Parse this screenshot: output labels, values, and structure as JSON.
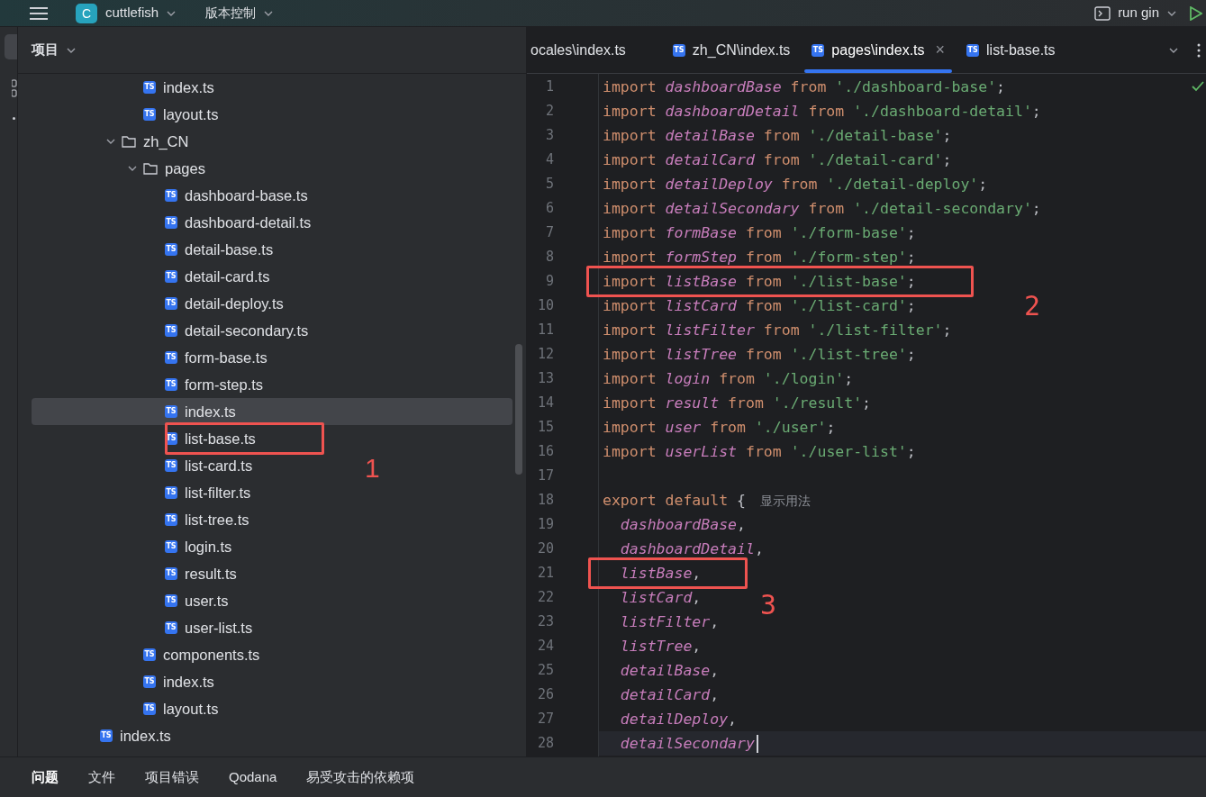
{
  "toolbar": {
    "project_badge": "C",
    "project": "cuttlefish",
    "vcs": "版本控制",
    "run_config": "run gin"
  },
  "project_panel": {
    "title": "项目",
    "tree": [
      {
        "children": [
          {
            "children": [
              {
                "name": "index.ts",
                "badge": "TS",
                "selected": false
              },
              {
                "name": "layout.ts",
                "badge": "TS",
                "selected": false
              }
            ]
          },
          {
            "name": "zh_CN",
            "expanded": true,
            "children": [
              {
                "name": "pages",
                "expanded": true,
                "children": [
                  {
                    "name": "dashboard-base.ts",
                    "badge": "TS",
                    "selected": false
                  },
                  {
                    "name": "dashboard-detail.ts",
                    "badge": "TS",
                    "selected": false
                  },
                  {
                    "name": "detail-base.ts",
                    "badge": "TS",
                    "selected": false
                  },
                  {
                    "name": "detail-card.ts",
                    "badge": "TS",
                    "selected": false
                  },
                  {
                    "name": "detail-deploy.ts",
                    "badge": "TS",
                    "selected": false
                  },
                  {
                    "name": "detail-secondary.ts",
                    "badge": "TS",
                    "selected": false
                  },
                  {
                    "name": "form-base.ts",
                    "badge": "TS",
                    "selected": false
                  },
                  {
                    "name": "form-step.ts",
                    "badge": "TS",
                    "selected": false
                  },
                  {
                    "name": "index.ts",
                    "badge": "TS",
                    "selected": true
                  },
                  {
                    "name": "list-base.ts",
                    "badge": "TS",
                    "selected": false,
                    "annotation": "1"
                  },
                  {
                    "name": "list-card.ts",
                    "badge": "TS",
                    "selected": false
                  },
                  {
                    "name": "list-filter.ts",
                    "badge": "TS",
                    "selected": false
                  },
                  {
                    "name": "list-tree.ts",
                    "badge": "TS",
                    "selected": false
                  },
                  {
                    "name": "login.ts",
                    "badge": "TS",
                    "selected": false
                  },
                  {
                    "name": "result.ts",
                    "badge": "TS",
                    "selected": false
                  },
                  {
                    "name": "user.ts",
                    "badge": "TS",
                    "selected": false
                  },
                  {
                    "name": "user-list.ts",
                    "badge": "TS",
                    "selected": false
                  }
                ]
              },
              {
                "name": "components.ts",
                "badge": "TS",
                "selected": false
              },
              {
                "name": "index.ts",
                "badge": "TS",
                "selected": false
              },
              {
                "name": "layout.ts",
                "badge": "TS",
                "selected": false
              }
            ]
          }
        ]
      },
      {
        "name": "index.ts",
        "badge": "TS",
        "selected": false
      }
    ]
  },
  "editor_tabs": [
    {
      "label": "ocales\\index.ts",
      "selected": false
    },
    {
      "label": "zh_CN\\index.ts",
      "badge": "TS",
      "selected": false
    },
    {
      "label": "pages\\index.ts",
      "badge": "TS",
      "selected": true,
      "close": "×"
    },
    {
      "label": "list-base.ts",
      "badge": "TS",
      "selected": false
    }
  ],
  "code": [
    {
      "number": "1",
      "tokens": [
        {
          "kind": "keyword",
          "text": "import "
        },
        {
          "kind": "ident",
          "text": "dashboardBase"
        },
        {
          "kind": "keyword",
          "text": " from "
        },
        {
          "kind": "string",
          "text": "'./dashboard-base'"
        },
        {
          "kind": "plain",
          "text": ";"
        }
      ]
    },
    {
      "number": "2",
      "tokens": [
        {
          "kind": "keyword",
          "text": "import "
        },
        {
          "kind": "ident",
          "text": "dashboardDetail"
        },
        {
          "kind": "keyword",
          "text": " from "
        },
        {
          "kind": "string",
          "text": "'./dashboard-detail'"
        },
        {
          "kind": "plain",
          "text": ";"
        }
      ]
    },
    {
      "number": "3",
      "tokens": [
        {
          "kind": "keyword",
          "text": "import "
        },
        {
          "kind": "ident",
          "text": "detailBase"
        },
        {
          "kind": "keyword",
          "text": " from "
        },
        {
          "kind": "string",
          "text": "'./detail-base'"
        },
        {
          "kind": "plain",
          "text": ";"
        }
      ]
    },
    {
      "number": "4",
      "tokens": [
        {
          "kind": "keyword",
          "text": "import "
        },
        {
          "kind": "ident",
          "text": "detailCard"
        },
        {
          "kind": "keyword",
          "text": " from "
        },
        {
          "kind": "string",
          "text": "'./detail-card'"
        },
        {
          "kind": "plain",
          "text": ";"
        }
      ]
    },
    {
      "number": "5",
      "tokens": [
        {
          "kind": "keyword",
          "text": "import "
        },
        {
          "kind": "ident",
          "text": "detailDeploy"
        },
        {
          "kind": "keyword",
          "text": " from "
        },
        {
          "kind": "string",
          "text": "'./detail-deploy'"
        },
        {
          "kind": "plain",
          "text": ";"
        }
      ]
    },
    {
      "number": "6",
      "tokens": [
        {
          "kind": "keyword",
          "text": "import "
        },
        {
          "kind": "ident",
          "text": "detailSecondary"
        },
        {
          "kind": "keyword",
          "text": " from "
        },
        {
          "kind": "string",
          "text": "'./detail-secondary'"
        },
        {
          "kind": "plain",
          "text": ";"
        }
      ]
    },
    {
      "number": "7",
      "tokens": [
        {
          "kind": "keyword",
          "text": "import "
        },
        {
          "kind": "ident",
          "text": "formBase"
        },
        {
          "kind": "keyword",
          "text": " from "
        },
        {
          "kind": "string",
          "text": "'./form-base'"
        },
        {
          "kind": "plain",
          "text": ";"
        }
      ]
    },
    {
      "number": "8",
      "tokens": [
        {
          "kind": "keyword",
          "text": "import "
        },
        {
          "kind": "ident",
          "text": "formStep"
        },
        {
          "kind": "keyword",
          "text": " from "
        },
        {
          "kind": "string",
          "text": "'./form-step'"
        },
        {
          "kind": "plain",
          "text": ";"
        }
      ]
    },
    {
      "number": "9",
      "annotation": "2",
      "tokens": [
        {
          "kind": "keyword",
          "text": "import "
        },
        {
          "kind": "ident",
          "text": "listBase"
        },
        {
          "kind": "keyword",
          "text": " from "
        },
        {
          "kind": "string",
          "text": "'./list-base'"
        },
        {
          "kind": "plain",
          "text": ";"
        }
      ]
    },
    {
      "number": "10",
      "tokens": [
        {
          "kind": "keyword",
          "text": "import "
        },
        {
          "kind": "ident",
          "text": "listCard"
        },
        {
          "kind": "keyword",
          "text": " from "
        },
        {
          "kind": "string",
          "text": "'./list-card'"
        },
        {
          "kind": "plain",
          "text": ";"
        }
      ]
    },
    {
      "number": "11",
      "tokens": [
        {
          "kind": "keyword",
          "text": "import "
        },
        {
          "kind": "ident",
          "text": "listFilter"
        },
        {
          "kind": "keyword",
          "text": " from "
        },
        {
          "kind": "string",
          "text": "'./list-filter'"
        },
        {
          "kind": "plain",
          "text": ";"
        }
      ]
    },
    {
      "number": "12",
      "tokens": [
        {
          "kind": "keyword",
          "text": "import "
        },
        {
          "kind": "ident",
          "text": "listTree"
        },
        {
          "kind": "keyword",
          "text": " from "
        },
        {
          "kind": "string",
          "text": "'./list-tree'"
        },
        {
          "kind": "plain",
          "text": ";"
        }
      ]
    },
    {
      "number": "13",
      "tokens": [
        {
          "kind": "keyword",
          "text": "import "
        },
        {
          "kind": "ident",
          "text": "login"
        },
        {
          "kind": "keyword",
          "text": " from "
        },
        {
          "kind": "string",
          "text": "'./login'"
        },
        {
          "kind": "plain",
          "text": ";"
        }
      ]
    },
    {
      "number": "14",
      "tokens": [
        {
          "kind": "keyword",
          "text": "import "
        },
        {
          "kind": "ident",
          "text": "result"
        },
        {
          "kind": "keyword",
          "text": " from "
        },
        {
          "kind": "string",
          "text": "'./result'"
        },
        {
          "kind": "plain",
          "text": ";"
        }
      ]
    },
    {
      "number": "15",
      "tokens": [
        {
          "kind": "keyword",
          "text": "import "
        },
        {
          "kind": "ident",
          "text": "user"
        },
        {
          "kind": "keyword",
          "text": " from "
        },
        {
          "kind": "string",
          "text": "'./user'"
        },
        {
          "kind": "plain",
          "text": ";"
        }
      ]
    },
    {
      "number": "16",
      "tokens": [
        {
          "kind": "keyword",
          "text": "import "
        },
        {
          "kind": "ident",
          "text": "userList"
        },
        {
          "kind": "keyword",
          "text": " from "
        },
        {
          "kind": "string",
          "text": "'./user-list'"
        },
        {
          "kind": "plain",
          "text": ";"
        }
      ]
    },
    {
      "number": "17"
    },
    {
      "number": "18",
      "tokens": [
        {
          "kind": "keyword",
          "text": "export default "
        },
        {
          "kind": "plain",
          "text": "{"
        },
        {
          "kind": "hint",
          "text": "显示用法"
        }
      ]
    },
    {
      "number": "19",
      "tokens": [
        {
          "kind": "ident",
          "text": "  dashboardBase"
        },
        {
          "kind": "plain",
          "text": ","
        }
      ]
    },
    {
      "number": "20",
      "tokens": [
        {
          "kind": "ident",
          "text": "  dashboardDetail"
        },
        {
          "kind": "plain",
          "text": ","
        }
      ]
    },
    {
      "number": "21",
      "annotation": "3",
      "tokens": [
        {
          "kind": "ident",
          "text": "  listBase"
        },
        {
          "kind": "plain",
          "text": ","
        }
      ]
    },
    {
      "number": "22",
      "tokens": [
        {
          "kind": "ident",
          "text": "  listCard"
        },
        {
          "kind": "plain",
          "text": ","
        }
      ]
    },
    {
      "number": "23",
      "tokens": [
        {
          "kind": "ident",
          "text": "  listFilter"
        },
        {
          "kind": "plain",
          "text": ","
        }
      ]
    },
    {
      "number": "24",
      "tokens": [
        {
          "kind": "ident",
          "text": "  listTree"
        },
        {
          "kind": "plain",
          "text": ","
        }
      ]
    },
    {
      "number": "25",
      "tokens": [
        {
          "kind": "ident",
          "text": "  detailBase"
        },
        {
          "kind": "plain",
          "text": ","
        }
      ]
    },
    {
      "number": "26",
      "tokens": [
        {
          "kind": "ident",
          "text": "  detailCard"
        },
        {
          "kind": "plain",
          "text": ","
        }
      ]
    },
    {
      "number": "27",
      "tokens": [
        {
          "kind": "ident",
          "text": "  detailDeploy"
        },
        {
          "kind": "plain",
          "text": ","
        }
      ]
    },
    {
      "number": "28",
      "current": true,
      "tokens": [
        {
          "kind": "ident",
          "text": "  detailSecondary"
        }
      ]
    }
  ],
  "bottom_tabs": [
    {
      "label": "问题",
      "selected": true
    },
    {
      "label": "文件",
      "selected": false
    },
    {
      "label": "项目错误",
      "selected": false
    },
    {
      "label": "Qodana",
      "selected": false
    },
    {
      "label": "易受攻击的依赖项",
      "selected": false
    }
  ]
}
